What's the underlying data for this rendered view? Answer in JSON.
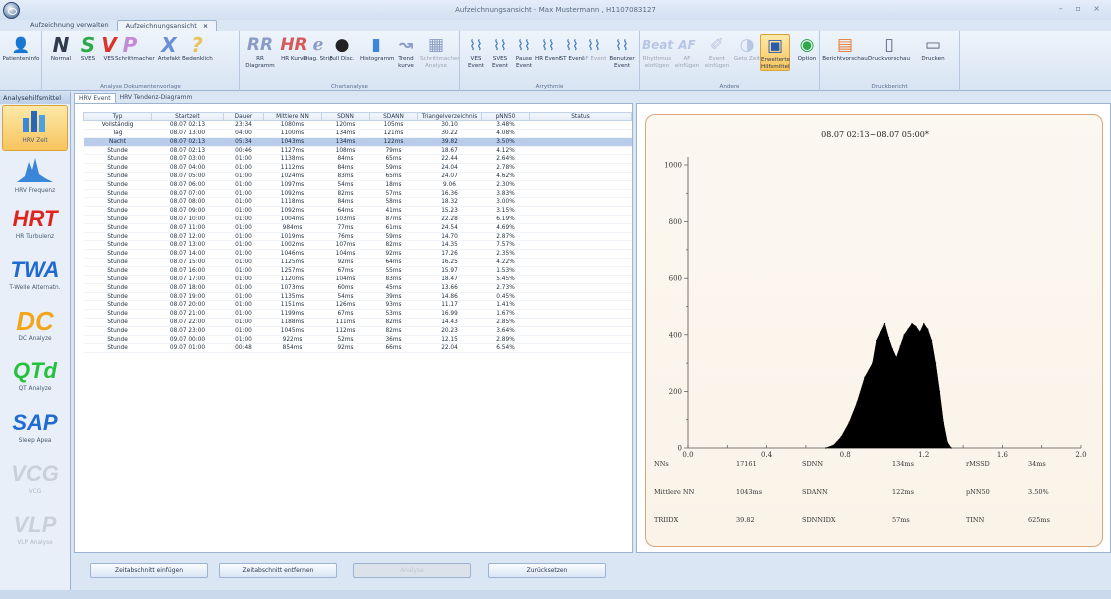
{
  "window": {
    "title": "Aufzeichnungsansicht  -  Max Mustermann , H1107083127",
    "doc_tabs": [
      "Aufzeichnung verwalten",
      "Aufzeichnungsansicht"
    ],
    "close_glyph": "×",
    "controls": "–  ▫  ×"
  },
  "ribbon": {
    "groups": [
      {
        "label": "",
        "buttons": [
          {
            "label": "Patienteninfo",
            "icon": "patient-icon"
          }
        ]
      },
      {
        "label": "Analyse Dokumentenvorlage",
        "buttons": [
          {
            "label": "Normal",
            "glyph": "N",
            "color": "#2f3b4d"
          },
          {
            "label": "SVES",
            "glyph": "S",
            "color": "#2fa84a"
          },
          {
            "label": "VES",
            "glyph": "V",
            "color": "#d8342c"
          },
          {
            "label": "Schrittmacher",
            "glyph": "P",
            "color": "#c38ad8"
          },
          {
            "label": "Artefakt",
            "glyph": "X",
            "color": "#6b8ed6"
          },
          {
            "label": "Bedenklich",
            "glyph": "?",
            "color": "#e8c35c"
          }
        ]
      },
      {
        "label": "Chartanalyse",
        "buttons": [
          {
            "label": "RR Diagramm",
            "glyph": "RR"
          },
          {
            "label": "HR Kurve",
            "glyph": "HR"
          },
          {
            "label": "Diag. Strip",
            "glyph": "ℯ"
          },
          {
            "label": "Full Disc.",
            "glyph": "●"
          },
          {
            "label": "Histogramm",
            "glyph": "▮"
          },
          {
            "label": "Trend kurve",
            "glyph": "↝"
          },
          {
            "label": "Schrittmacher Analyse",
            "glyph": "▦"
          }
        ]
      },
      {
        "label": "Arrythmie",
        "buttons": [
          {
            "label": "VES Event"
          },
          {
            "label": "SVES Event"
          },
          {
            "label": "Pause Event"
          },
          {
            "label": "HR Event"
          },
          {
            "label": "ST Event"
          },
          {
            "label": "AF Event"
          },
          {
            "label": "Benutzer Event"
          }
        ]
      },
      {
        "label": "Andere",
        "buttons": [
          {
            "label": "Rhythmus einfügen",
            "glyph": "Beat"
          },
          {
            "label": "AF einfügen",
            "glyph": "AF"
          },
          {
            "label": "Event einfügen",
            "glyph": "✐"
          },
          {
            "label": "Geto Zeit",
            "glyph": "◑"
          },
          {
            "label": "Erweiterte Hilfsmittel",
            "glyph": "▣"
          },
          {
            "label": "Option",
            "glyph": "◉"
          }
        ]
      },
      {
        "label": "Druckbericht",
        "buttons": [
          {
            "label": "Berichtvorschau",
            "glyph": "▤"
          },
          {
            "label": "Druckvorschau",
            "glyph": "▯"
          },
          {
            "label": "Drucken",
            "glyph": "▭"
          }
        ]
      }
    ]
  },
  "sidebar": {
    "title": "Analysehilfsmittel",
    "items": [
      {
        "label": "HRV Zeit",
        "glyph": "",
        "color": "#3a76b8"
      },
      {
        "label": "HRV Frequenz",
        "glyph": "",
        "color": "#3a76b8"
      },
      {
        "label": "HR Turbulenz",
        "glyph": "HRT",
        "color": "#e0231d"
      },
      {
        "label": "T-Welle Alternatn.",
        "glyph": "TWA",
        "color": "#1f6bd0"
      },
      {
        "label": "DC Analyze",
        "glyph": "DC",
        "color": "#f2a51a"
      },
      {
        "label": "QT Analyze",
        "glyph": "QTd",
        "color": "#24c23a"
      },
      {
        "label": "Sleep Apea",
        "glyph": "SAP",
        "color": "#1f6bd0"
      },
      {
        "label": "VCG",
        "glyph": "VCG",
        "color": "#c9d0da"
      },
      {
        "label": "VLP Analyse",
        "glyph": "VLP",
        "color": "#c9d0da"
      }
    ]
  },
  "content_tabs": [
    "HRV Event",
    "HRV Tendenz-Diagramm"
  ],
  "table": {
    "headers": [
      "Typ",
      "Startzeit",
      "Dauer",
      "Mittlere NN",
      "SDNN",
      "SDANN",
      "Triangelverzeichnis",
      "pNN50",
      "Status"
    ],
    "selected_row": 2,
    "rows": [
      [
        "Vollständig",
        "08.07 02:13",
        "23:34",
        "1080ms",
        "120ms",
        "105ms",
        "30.10",
        "3.48%",
        ""
      ],
      [
        "Tag",
        "08.07 13:00",
        "04:00",
        "1100ms",
        "134ms",
        "121ms",
        "30.22",
        "4.08%",
        ""
      ],
      [
        "Nacht",
        "08.07 02:13",
        "05:34",
        "1043ms",
        "134ms",
        "122ms",
        "39.82",
        "3.50%",
        ""
      ],
      [
        "Stunde",
        "08.07 02:13",
        "00:46",
        "1127ms",
        "108ms",
        "79ms",
        "18.67",
        "4.12%",
        ""
      ],
      [
        "Stunde",
        "08.07 03:00",
        "01:00",
        "1138ms",
        "84ms",
        "65ms",
        "22.44",
        "2.64%",
        ""
      ],
      [
        "Stunde",
        "08.07 04:00",
        "01:00",
        "1112ms",
        "84ms",
        "59ms",
        "24.04",
        "2.78%",
        ""
      ],
      [
        "Stunde",
        "08.07 05:00",
        "01:00",
        "1024ms",
        "83ms",
        "65ms",
        "24.07",
        "4.62%",
        ""
      ],
      [
        "Stunde",
        "08.07 06:00",
        "01:00",
        "1097ms",
        "54ms",
        "18ms",
        "9.06",
        "2.30%",
        ""
      ],
      [
        "Stunde",
        "08.07 07:00",
        "01:00",
        "1092ms",
        "82ms",
        "57ms",
        "16.36",
        "3.83%",
        ""
      ],
      [
        "Stunde",
        "08.07 08:00",
        "01:00",
        "1118ms",
        "84ms",
        "58ms",
        "18.32",
        "3.00%",
        ""
      ],
      [
        "Stunde",
        "08.07 09:00",
        "01:00",
        "1092ms",
        "64ms",
        "41ms",
        "15.23",
        "3.15%",
        ""
      ],
      [
        "Stunde",
        "08.07 10:00",
        "01:00",
        "1004ms",
        "103ms",
        "87ms",
        "22.28",
        "6.19%",
        ""
      ],
      [
        "Stunde",
        "08.07 11:00",
        "01:00",
        "984ms",
        "77ms",
        "61ms",
        "24.54",
        "4.69%",
        ""
      ],
      [
        "Stunde",
        "08.07 12:00",
        "01:00",
        "1019ms",
        "76ms",
        "59ms",
        "14.70",
        "2.87%",
        ""
      ],
      [
        "Stunde",
        "08.07 13:00",
        "01:00",
        "1002ms",
        "107ms",
        "82ms",
        "14.35",
        "7.57%",
        ""
      ],
      [
        "Stunde",
        "08.07 14:00",
        "01:00",
        "1046ms",
        "104ms",
        "92ms",
        "17.26",
        "2.35%",
        ""
      ],
      [
        "Stunde",
        "08.07 15:00",
        "01:00",
        "1125ms",
        "92ms",
        "64ms",
        "16.25",
        "4.22%",
        ""
      ],
      [
        "Stunde",
        "08.07 16:00",
        "01:00",
        "1257ms",
        "67ms",
        "55ms",
        "15.97",
        "1.53%",
        ""
      ],
      [
        "Stunde",
        "08.07 17:00",
        "01:00",
        "1120ms",
        "104ms",
        "83ms",
        "18.47",
        "5.45%",
        ""
      ],
      [
        "Stunde",
        "08.07 18:00",
        "01:00",
        "1073ms",
        "60ms",
        "45ms",
        "13.66",
        "2.73%",
        ""
      ],
      [
        "Stunde",
        "08.07 19:00",
        "01:00",
        "1135ms",
        "54ms",
        "39ms",
        "14.86",
        "0.45%",
        ""
      ],
      [
        "Stunde",
        "08.07 20:00",
        "01:00",
        "1151ms",
        "126ms",
        "93ms",
        "11.17",
        "1.41%",
        ""
      ],
      [
        "Stunde",
        "08.07 21:00",
        "01:00",
        "1199ms",
        "67ms",
        "53ms",
        "16.99",
        "1.67%",
        ""
      ],
      [
        "Stunde",
        "08.07 22:00",
        "01:00",
        "1188ms",
        "111ms",
        "82ms",
        "14.43",
        "2.85%",
        ""
      ],
      [
        "Stunde",
        "08.07 23:00",
        "01:00",
        "1045ms",
        "112ms",
        "82ms",
        "20.23",
        "3.64%",
        ""
      ],
      [
        "Stunde",
        "09.07 00:00",
        "01:00",
        "922ms",
        "52ms",
        "36ms",
        "12.15",
        "2.89%",
        ""
      ],
      [
        "Stunde",
        "09.07 01:00",
        "00:48",
        "854ms",
        "92ms",
        "66ms",
        "22.04",
        "6.54%",
        ""
      ]
    ]
  },
  "buttons": {
    "insert_segment": "Zeitabschnitt einfügen",
    "remove_segment": "Zeitabschnitt entfernen",
    "analyze": "Analyse",
    "reset": "Zurücksetzen"
  },
  "chart_data": {
    "type": "area",
    "title": "08.07 02:13~08.07 05:00*",
    "xlim": [
      0.0,
      2.0
    ],
    "ylim": [
      0,
      1000
    ],
    "x_ticks": [
      "0.0",
      "0.4",
      "0.8",
      "1.2",
      "1.6",
      "2.0"
    ],
    "y_ticks": [
      "0",
      "200",
      "400",
      "600",
      "800",
      "1000"
    ],
    "fill_color": "#000000",
    "x": [
      0.7,
      0.74,
      0.78,
      0.82,
      0.86,
      0.9,
      0.94,
      0.96,
      0.98,
      1.0,
      1.02,
      1.04,
      1.06,
      1.08,
      1.1,
      1.12,
      1.14,
      1.16,
      1.18,
      1.2,
      1.22,
      1.24,
      1.26,
      1.28,
      1.3,
      1.32,
      1.34
    ],
    "y": [
      0,
      10,
      40,
      90,
      160,
      250,
      300,
      380,
      410,
      440,
      390,
      350,
      320,
      360,
      400,
      420,
      440,
      430,
      410,
      440,
      420,
      380,
      300,
      200,
      90,
      20,
      0
    ]
  },
  "stats": [
    [
      {
        "k": "NNs",
        "v": "17161"
      },
      {
        "k": "SDNN",
        "v": "134ms"
      },
      {
        "k": "rMSSD",
        "v": "34ms"
      }
    ],
    [
      {
        "k": "Mittlere NN",
        "v": "1043ms"
      },
      {
        "k": "SDANN",
        "v": "122ms"
      },
      {
        "k": "pNN50",
        "v": "3.50%"
      }
    ],
    [
      {
        "k": "TRIIDX",
        "v": "39.82"
      },
      {
        "k": "SDNNIDX",
        "v": "57ms"
      },
      {
        "k": "TINN",
        "v": "625ms"
      }
    ]
  ]
}
